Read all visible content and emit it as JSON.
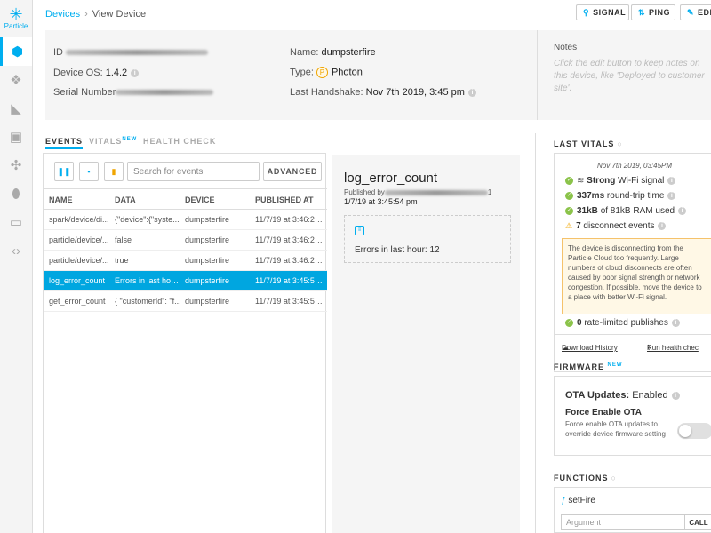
{
  "brand": {
    "logo_text": "Particle"
  },
  "breadcrumb": {
    "devices": "Devices",
    "current": "View Device"
  },
  "toolbar": {
    "signal": "SIGNAL",
    "ping": "PING",
    "edit": "EDI"
  },
  "device": {
    "id_label": "ID",
    "os_label": "Device OS:",
    "os_value": "1.4.2",
    "serial_label": "Serial Number",
    "name_label": "Name:",
    "name_value": "dumpsterfire",
    "type_label": "Type:",
    "type_badge": "P",
    "type_value": "Photon",
    "handshake_label": "Last Handshake:",
    "handshake_value": "Nov 7th 2019, 3:45 pm"
  },
  "notes": {
    "title": "Notes",
    "placeholder": "Click the edit button to keep notes on this device, like 'Deployed to customer site'."
  },
  "tabs": [
    {
      "label": "EVENTS",
      "active": true
    },
    {
      "label": "VITALS",
      "badge": "NEW",
      "active": false
    },
    {
      "label": "HEALTH CHECK",
      "active": false
    }
  ],
  "events": {
    "search_placeholder": "Search for events",
    "advanced": "ADVANCED",
    "columns": [
      "NAME",
      "DATA",
      "DEVICE",
      "PUBLISHED AT"
    ],
    "rows": [
      {
        "name": "spark/device/di...",
        "data": "{\"device\":{\"syste...",
        "device": "dumpsterfire",
        "published": "11/7/19 at 3:46:26 ..."
      },
      {
        "name": "particle/device/...",
        "data": "false",
        "device": "dumpsterfire",
        "published": "11/7/19 at 3:46:26 ..."
      },
      {
        "name": "particle/device/...",
        "data": "true",
        "device": "dumpsterfire",
        "published": "11/7/19 at 3:46:26 ..."
      },
      {
        "name": "log_error_count",
        "data": "Errors in last hour...",
        "device": "dumpsterfire",
        "published": "11/7/19 at 3:45:54 ...",
        "selected": true
      },
      {
        "name": "get_error_count",
        "data": "{ \"customerId\": \"f...",
        "device": "dumpsterfire",
        "published": "11/7/19 at 3:45:54 ..."
      }
    ]
  },
  "detail": {
    "title": "log_error_count",
    "published_by": "Published by",
    "published_suffix": "1",
    "published_date": "1/7/19 at 3:45:54 pm",
    "value": "Errors in last hour: 12"
  },
  "vitals": {
    "title": "LAST VITALS",
    "timestamp": "Nov 7th 2019, 03:45PM",
    "signal_strong": "Strong",
    "signal_rest": "Wi-Fi signal",
    "rtt_value": "337ms",
    "rtt_rest": "round-trip time",
    "ram_value": "31kB",
    "ram_rest": "of 81kB RAM used",
    "disconnect_value": "7",
    "disconnect_rest": "disconnect events",
    "warning": "The device is disconnecting from the Particle Cloud too frequently. Large numbers of cloud disconnects are often caused by poor signal strength or network congestion. If possible, move the device to a place with better Wi-Fi signal.",
    "rate_value": "0",
    "rate_rest": "rate-limited publishes",
    "download": "Download History",
    "run_check": "Run health chec"
  },
  "firmware": {
    "title": "FIRMWARE",
    "badge": "NEW",
    "ota_label": "OTA Updates:",
    "ota_value": "Enabled",
    "force_title": "Force Enable OTA",
    "force_desc": "Force enable OTA updates to override device firmware setting"
  },
  "functions": {
    "title": "FUNCTIONS",
    "fn_name": "setFire",
    "arg_placeholder": "Argument",
    "call": "CALL"
  },
  "colors": {
    "accent": "#00aeef",
    "selected_row": "#00a6e0",
    "ok": "#8bc34a",
    "warning": "#f0a500"
  }
}
